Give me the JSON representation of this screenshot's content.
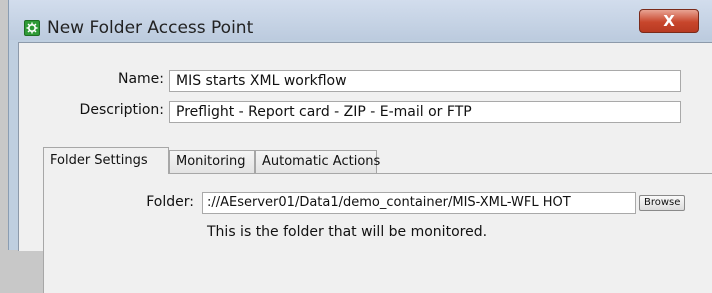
{
  "window": {
    "title": "New Folder Access Point",
    "close_label": "X",
    "icon": "gear-icon"
  },
  "form": {
    "name_label": "Name:",
    "name_value": "MIS starts XML workflow",
    "description_label": "Description:",
    "description_value": "Preflight - Report card - ZIP - E-mail or FTP"
  },
  "tabs": [
    {
      "label": "Folder Settings",
      "active": true
    },
    {
      "label": "Monitoring",
      "active": false
    },
    {
      "label": "Automatic Actions",
      "active": false
    }
  ],
  "folder_settings": {
    "folder_label": "Folder:",
    "folder_value": "://AEserver01/Data1/demo_container/MIS-XML-WFL HOT",
    "browse_label": "Browse",
    "hint": "This is the folder that will be monitored."
  },
  "colors": {
    "close_button": "#c8462c",
    "icon_green": "#2f9a36"
  }
}
